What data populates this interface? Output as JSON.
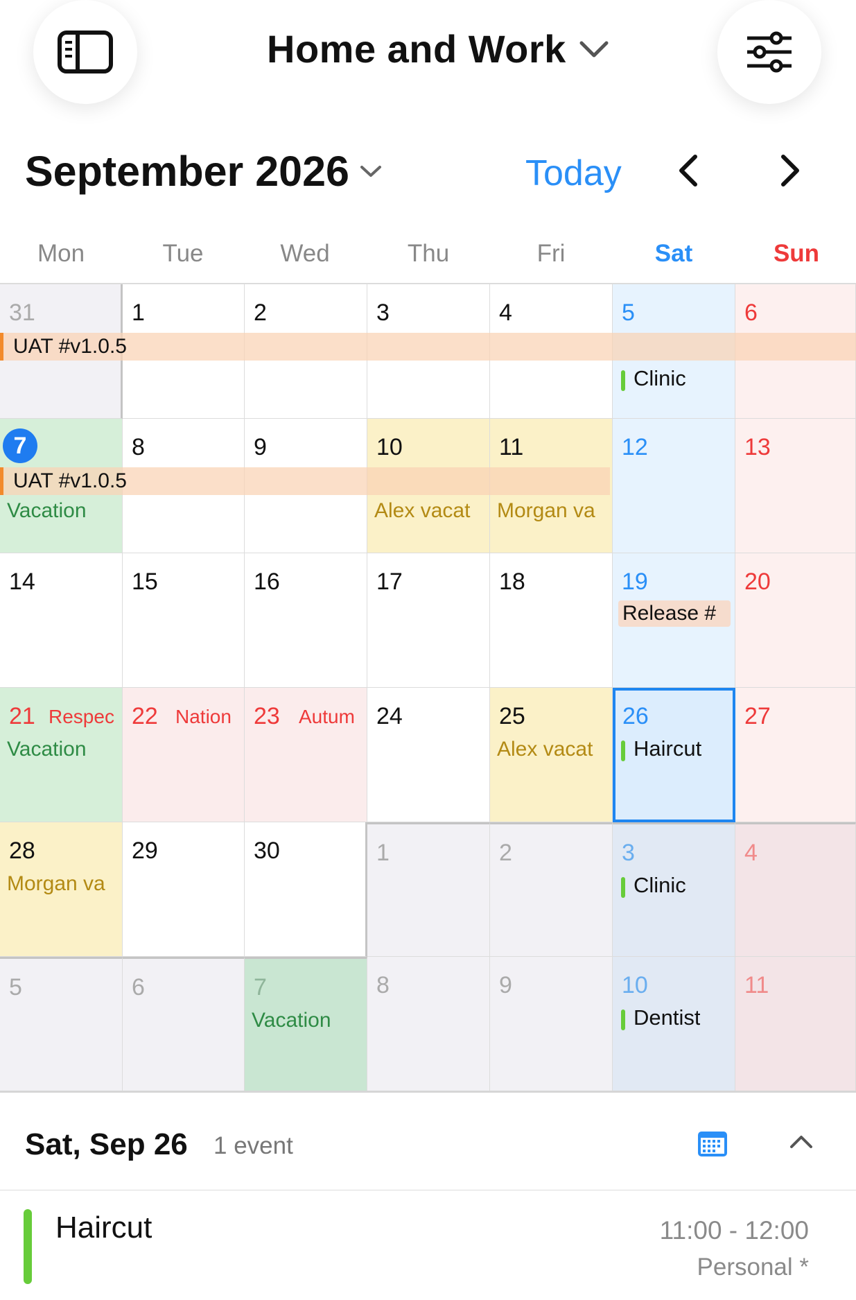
{
  "header": {
    "title": "Home and Work",
    "sidebar_icon": "sidebar-toggle-icon",
    "filter_icon": "sliders-icon"
  },
  "month_nav": {
    "month_label": "September 2026",
    "today_label": "Today"
  },
  "weekdays": [
    "Mon",
    "Tue",
    "Wed",
    "Thu",
    "Fri",
    "Sat",
    "Sun"
  ],
  "grid": {
    "rows": [
      [
        "31",
        "1",
        "2",
        "3",
        "4",
        "5",
        "6"
      ],
      [
        "7",
        "8",
        "9",
        "10",
        "11",
        "12",
        "13"
      ],
      [
        "14",
        "15",
        "16",
        "17",
        "18",
        "19",
        "20"
      ],
      [
        "21",
        "22",
        "23",
        "24",
        "25",
        "26",
        "27"
      ],
      [
        "28",
        "29",
        "30",
        "1",
        "2",
        "3",
        "4"
      ],
      [
        "5",
        "6",
        "7",
        "8",
        "9",
        "10",
        "11"
      ]
    ],
    "events": {
      "uat1": "UAT #v1.0.5",
      "uat2": "UAT #v1.0.5",
      "clinic1": "Clinic",
      "vacation1": "Vacation",
      "alex1": "Alex vacat",
      "morgan1": "Morgan va",
      "release": "Release #",
      "holiday21": "Respec",
      "holiday22": "Nation",
      "holiday23": "Autum",
      "vacation2": "Vacation",
      "alex2": "Alex vacat",
      "haircut": "Haircut",
      "morgan2": "Morgan va",
      "clinic2": "Clinic",
      "vacation3": "Vacation",
      "dentist": "Dentist"
    }
  },
  "detail": {
    "date": "Sat, Sep 26",
    "count": "1 event",
    "event": {
      "title": "Haircut",
      "time": "11:00 - 12:00",
      "calendar": "Personal *"
    }
  },
  "colors": {
    "accent": "#2a8ff7",
    "sunday": "#ee3a3a",
    "uat_bar": "#fadcc6",
    "vacation_bg": "#d6efd9",
    "alex_morgan_bg": "#fbf1c8",
    "holiday_bg": "#fbecec",
    "weekend_sat_bg": "#e7f3fe",
    "weekend_sun_bg": "#fdf0ef"
  }
}
